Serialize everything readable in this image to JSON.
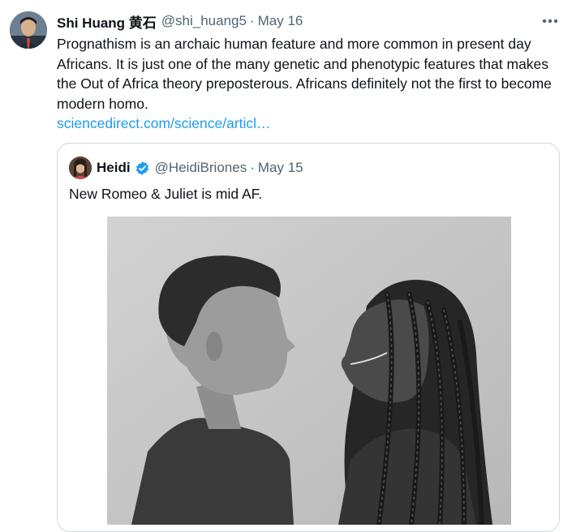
{
  "tweet": {
    "author_name": "Shi Huang 黄石",
    "author_handle": "@shi_huang5",
    "separator": "·",
    "date": "May 16",
    "text": "Prognathism is an archaic human feature and more common in present day Africans. It is just one of the many genetic and phenotypic features that makes the Out of Africa theory preposterous. Africans definitely not the first to become modern homo.",
    "link": "sciencedirect.com/science/articl…",
    "more_icon": "more-horizontal-icon"
  },
  "quoted_tweet": {
    "author_name": "Heidi",
    "author_handle": "@HeidiBriones",
    "separator": "·",
    "date": "May 15",
    "text": "New Romeo & Juliet is mid AF.",
    "verified_icon": "verified-badge-icon",
    "verified_color": "#1d9bf0"
  },
  "colors": {
    "text": "#0f1419",
    "secondary": "#536471",
    "link": "#1d9bf0",
    "border": "#cfd9de"
  }
}
